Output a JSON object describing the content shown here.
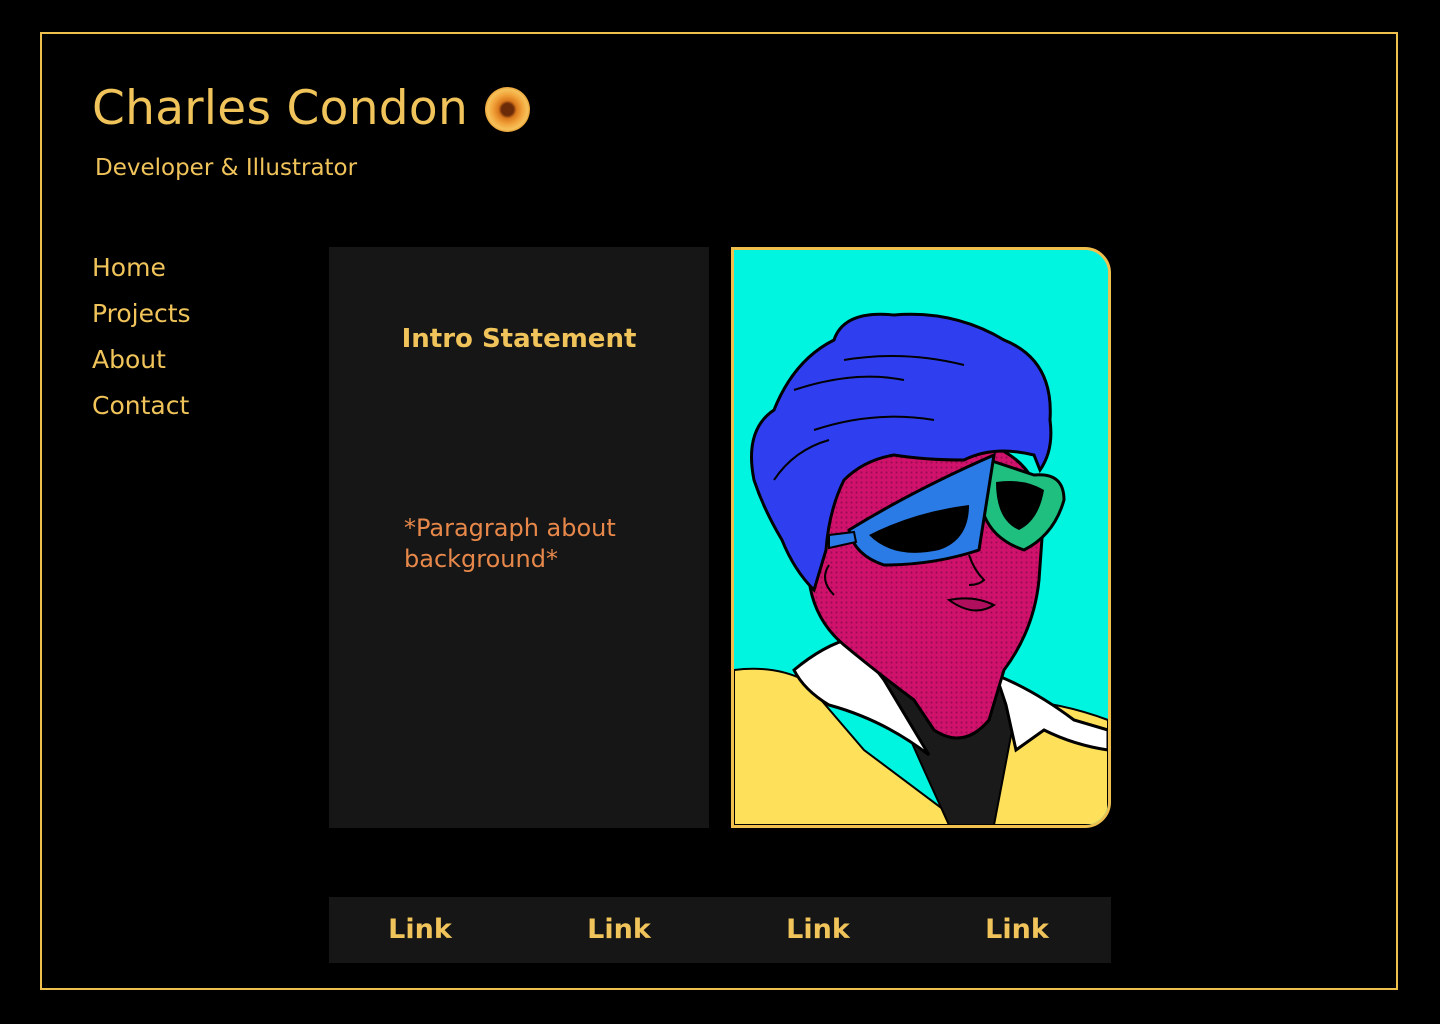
{
  "header": {
    "title": "Charles Condon",
    "subtitle": "Developer & Illustrator",
    "logo_icon": "sunflower-logo-icon"
  },
  "nav": {
    "items": [
      {
        "label": "Home"
      },
      {
        "label": "Projects"
      },
      {
        "label": "About"
      },
      {
        "label": "Contact"
      }
    ]
  },
  "intro": {
    "heading": "Intro Statement",
    "paragraph": "*Paragraph about background*"
  },
  "portrait": {
    "icon": "pop-art-portrait-image"
  },
  "footer": {
    "links": [
      {
        "label": "Link"
      },
      {
        "label": "Link"
      },
      {
        "label": "Link"
      },
      {
        "label": "Link"
      }
    ]
  },
  "colors": {
    "background": "#000000",
    "accent": "#f0c45a",
    "card": "#161616",
    "paragraph": "#e7884a",
    "portrait_bg": "#00f5e1"
  }
}
